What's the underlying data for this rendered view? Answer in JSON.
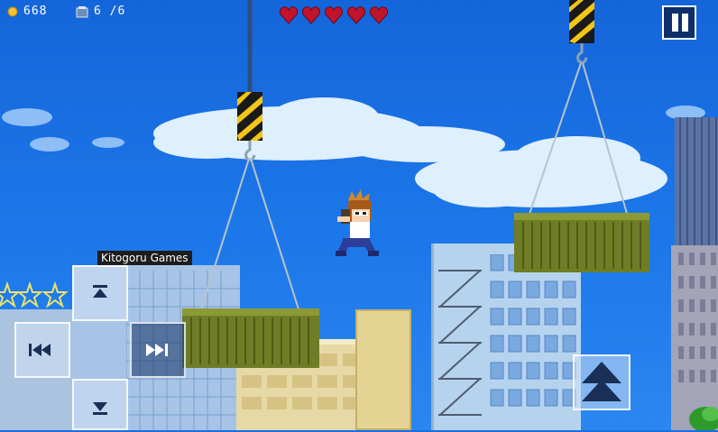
{
  "hud": {
    "coins": "668",
    "inventory": "6 /6",
    "hearts": 5,
    "coin_icon": "coin-icon",
    "card_icon": "card-icon",
    "heart_icon": "heart-icon",
    "heart_color": "#c0142c"
  },
  "controls": {
    "pause_icon": "pause-icon",
    "up_icon": "up-icon",
    "down_icon": "down-icon",
    "rewind_icon": "rewind-icon",
    "fast_forward_icon": "fast-forward-icon",
    "jump_icon": "jump-icon"
  },
  "sign": {
    "text": "Kitogoru Games"
  },
  "colors": {
    "sky": "#1c78ea",
    "container": "#6f7d26",
    "hazard_yellow": "#f3c517"
  }
}
